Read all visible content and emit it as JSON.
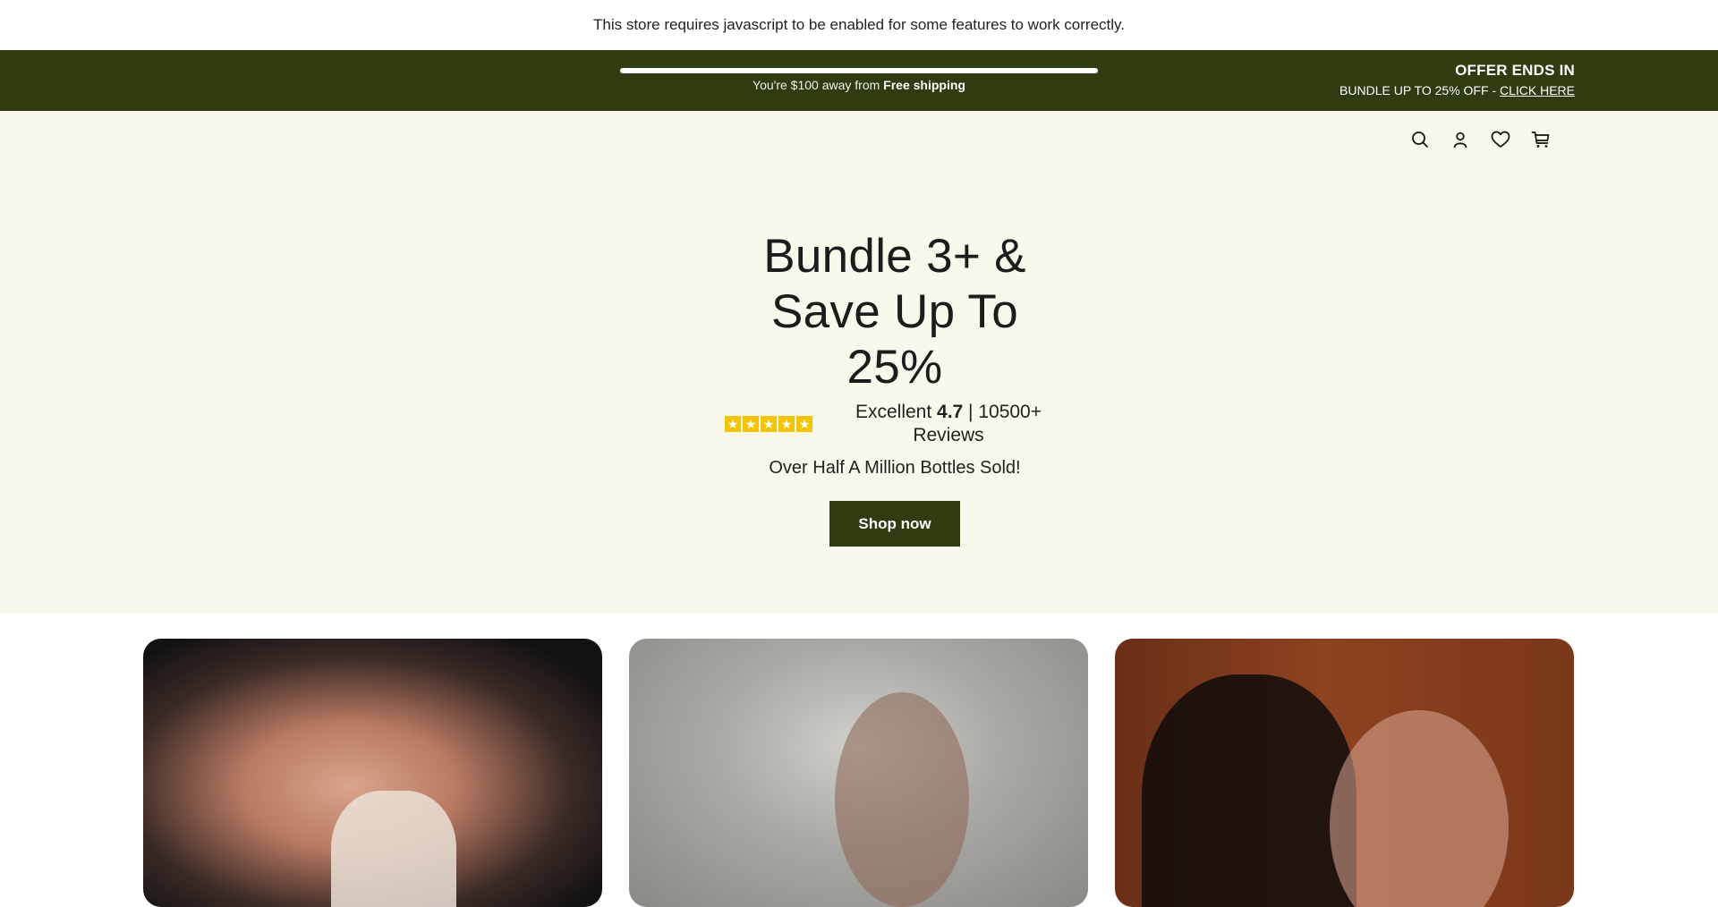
{
  "noscript": {
    "message": "This store requires javascript to be enabled for some features to work correctly."
  },
  "promo": {
    "shipping_prefix": "You're $100 away from ",
    "shipping_bold": "Free shipping",
    "shipping_progress": 1.0,
    "offer_title": "OFFER ENDS IN",
    "offer_sub": "BUNDLE UP TO 25% OFF - ",
    "offer_link": "CLICK HERE"
  },
  "header": {
    "icons": [
      "search-icon",
      "account-icon",
      "wishlist-icon",
      "cart-icon"
    ]
  },
  "hero": {
    "title": "Bundle 3+ & Save Up To 25%",
    "rating_prefix": "Excellent ",
    "rating_value": "4.7",
    "rating_suffix": " | 10500+ Reviews",
    "stars": 5,
    "bottles": "Over Half A Million Bottles Sold!",
    "cta": "Shop now"
  },
  "colors": {
    "brand": "#2f3b10",
    "hero_bg": "#f8f8ec",
    "star": "#f5c400"
  }
}
